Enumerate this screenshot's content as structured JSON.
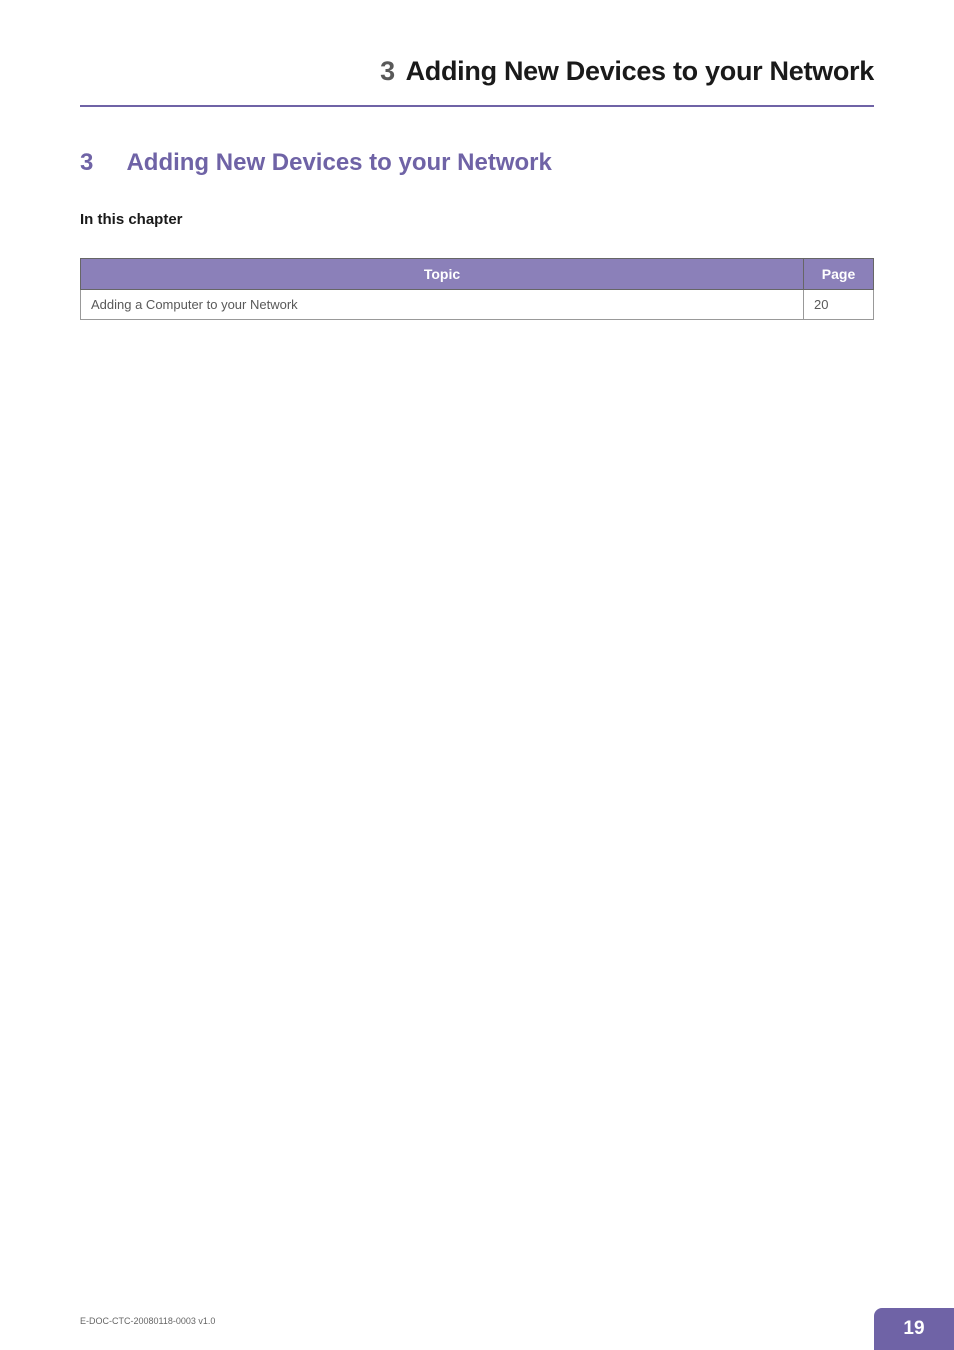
{
  "header": {
    "number": "3",
    "title": "Adding New Devices to your Network"
  },
  "section": {
    "number": "3",
    "name": "Adding New Devices to your Network"
  },
  "subheading": "In this chapter",
  "table": {
    "headers": {
      "topic": "Topic",
      "page": "Page"
    },
    "rows": [
      {
        "topic": "Adding a Computer to your Network",
        "page": "20"
      }
    ]
  },
  "footer": {
    "doc_id": "E-DOC-CTC-20080118-0003 v1.0",
    "page_number": "19"
  }
}
